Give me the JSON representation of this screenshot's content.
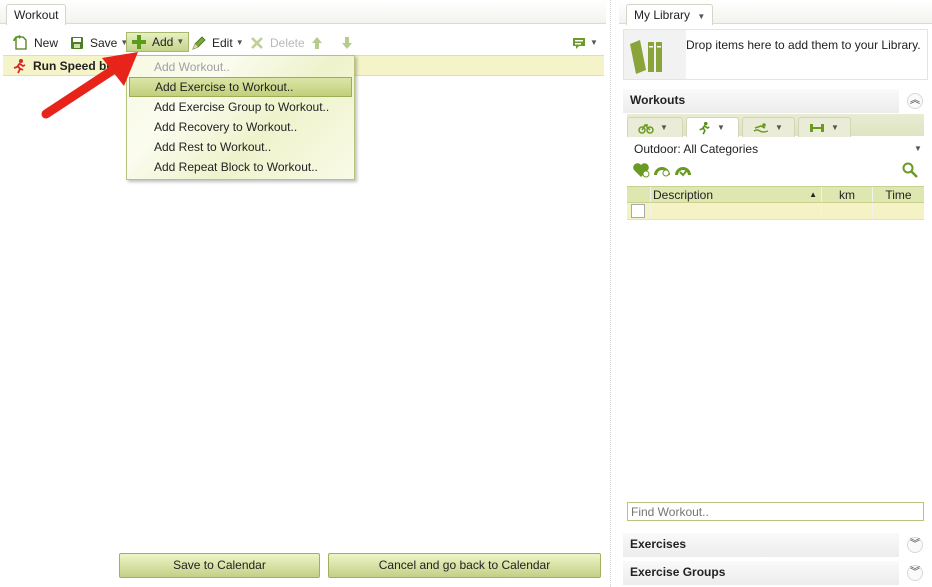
{
  "left_tab": "Workout",
  "toolbar": {
    "new_label": "New",
    "save_label": "Save",
    "add_label": "Add",
    "edit_label": "Edit",
    "delete_label": "Delete"
  },
  "workout_title": "Run Speed buil",
  "add_menu": [
    {
      "label": "Add Workout..",
      "disabled": true
    },
    {
      "label": "Add Exercise to Workout..",
      "hover": true
    },
    {
      "label": "Add Exercise Group to Workout.."
    },
    {
      "label": "Add Recovery to Workout.."
    },
    {
      "label": "Add Rest to Workout.."
    },
    {
      "label": "Add Repeat Block to Workout.."
    }
  ],
  "buttons": {
    "save_calendar": "Save to Calendar",
    "cancel_calendar": "Cancel and go back to Calendar"
  },
  "library": {
    "tab": "My Library",
    "drop_hint": "Drop items here to add them to your Library."
  },
  "workouts": {
    "header": "Workouts",
    "category": "Outdoor: All Categories",
    "columns": [
      "Description",
      "km",
      "Time"
    ],
    "find_placeholder": "Find Workout.."
  },
  "exercises_header": "Exercises",
  "exercise_groups_header": "Exercise Groups",
  "colors": {
    "accent_green": "#8aa33a",
    "highlight": "#f5f3c8",
    "arrow_red": "#e8231a"
  }
}
